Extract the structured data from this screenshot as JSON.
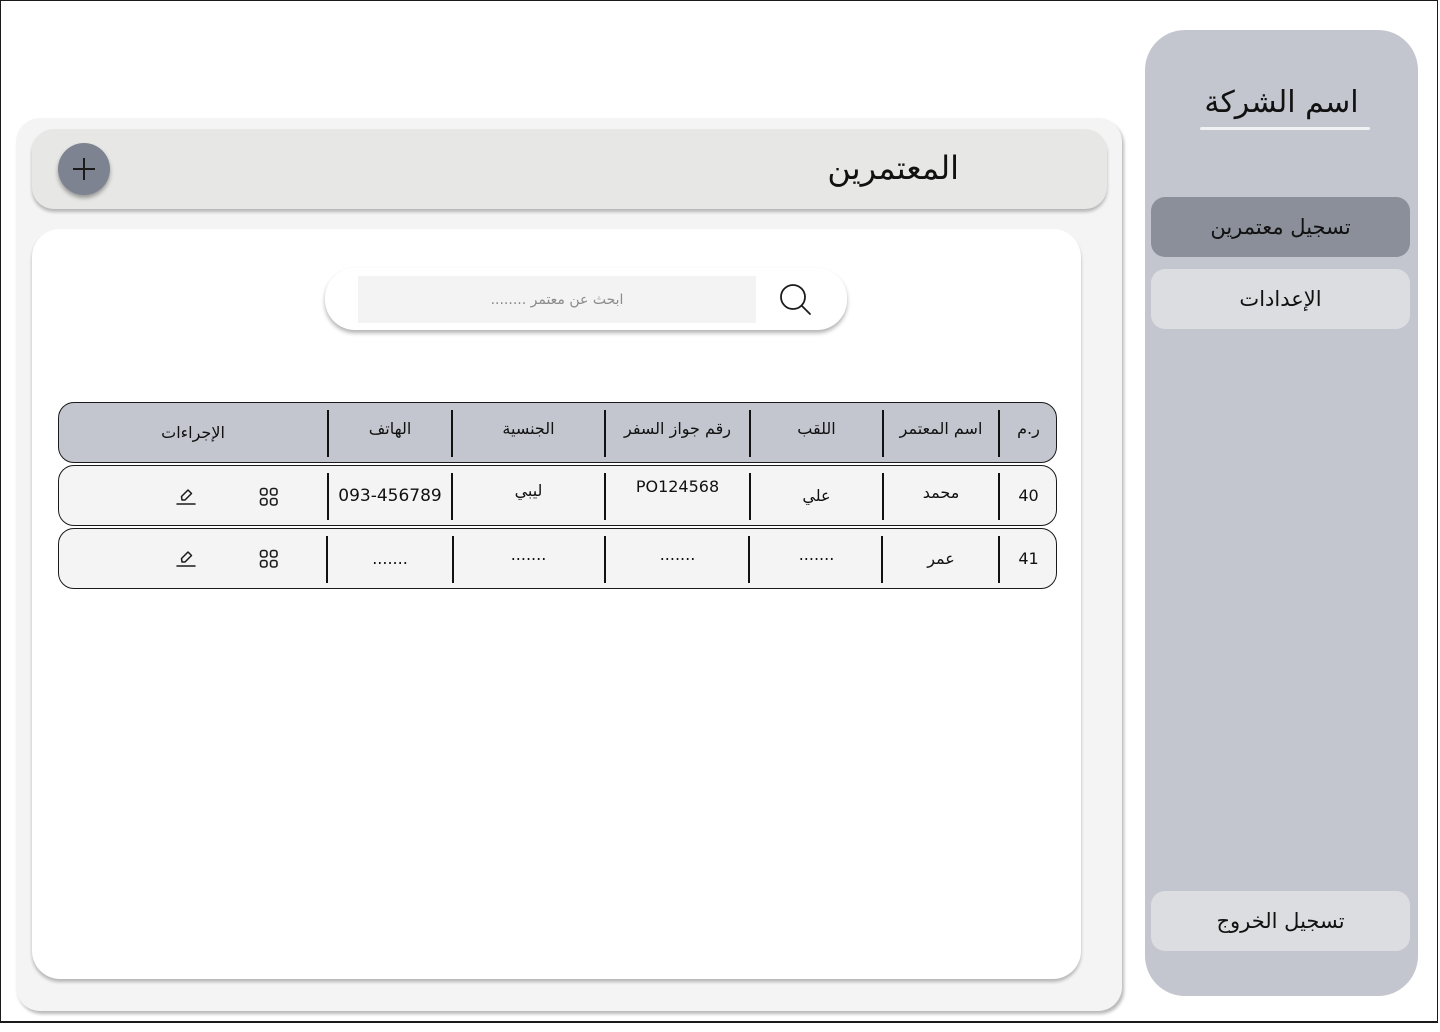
{
  "sidebar": {
    "company_name": "اسم الشركة",
    "items": [
      {
        "label": "تسجيل معتمرين",
        "active": true
      },
      {
        "label": "الإعدادات",
        "active": false
      }
    ],
    "logout_label": "تسجيل الخروج"
  },
  "header": {
    "title": "المعتمرين",
    "add_icon": "plus-icon"
  },
  "search": {
    "placeholder": "ابحث عن معتمر ........",
    "value": "",
    "icon": "search-icon"
  },
  "table": {
    "columns": [
      "ر.م",
      "اسم المعتمر",
      "اللقب",
      "رقم جواز السفر",
      "الجنسية",
      "الهاتف",
      "الإجراءات"
    ],
    "rows": [
      {
        "num": "40",
        "name": "محمد",
        "surname": "علي",
        "passport": "PO124568",
        "nationality": "ليبي",
        "phone": "093-456789"
      },
      {
        "num": "41",
        "name": "عمر",
        "surname": ".......",
        "passport": ".......",
        "nationality": ".......",
        "phone": "......."
      }
    ],
    "action_icons": [
      "grid-icon",
      "edit-icon"
    ]
  },
  "colors": {
    "sidebar_bg": "#c3c6ce",
    "active_item": "#8a8f99",
    "table_header": "#c3c6ce",
    "add_button": "#7d8390"
  }
}
